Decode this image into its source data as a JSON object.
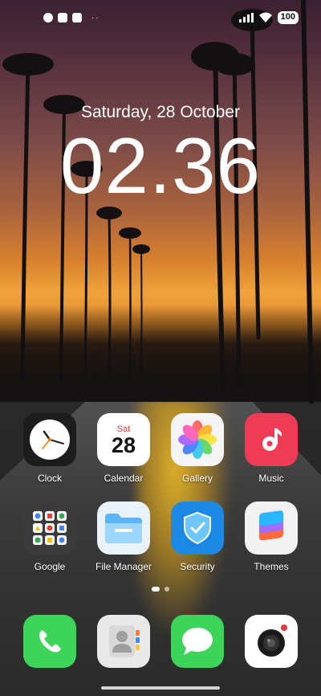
{
  "status": {
    "battery": "100",
    "notif_dots": "··"
  },
  "lockscreen": {
    "date": "Saturday, 28 October",
    "time": "02.36"
  },
  "apps_row1": [
    {
      "label": "Clock",
      "icon": "clock-icon"
    },
    {
      "label": "Calendar",
      "icon": "calendar-icon",
      "day": "Sat",
      "date": "28"
    },
    {
      "label": "Gallery",
      "icon": "gallery-icon"
    },
    {
      "label": "Music",
      "icon": "music-icon"
    }
  ],
  "apps_row2": [
    {
      "label": "Google",
      "icon": "google-folder-icon"
    },
    {
      "label": "File Manager",
      "icon": "folder-icon"
    },
    {
      "label": "Security",
      "icon": "shield-icon"
    },
    {
      "label": "Themes",
      "icon": "themes-icon"
    }
  ],
  "dock": [
    {
      "icon": "phone-icon"
    },
    {
      "icon": "contacts-icon"
    },
    {
      "icon": "messages-icon"
    },
    {
      "icon": "camera-icon"
    }
  ],
  "page_indicator": {
    "pages": 2,
    "current": 1
  },
  "colors": {
    "music": "#ef3b55",
    "security": "#1e88e5",
    "phone": "#3ed45a",
    "messages": "#3ed45a"
  }
}
